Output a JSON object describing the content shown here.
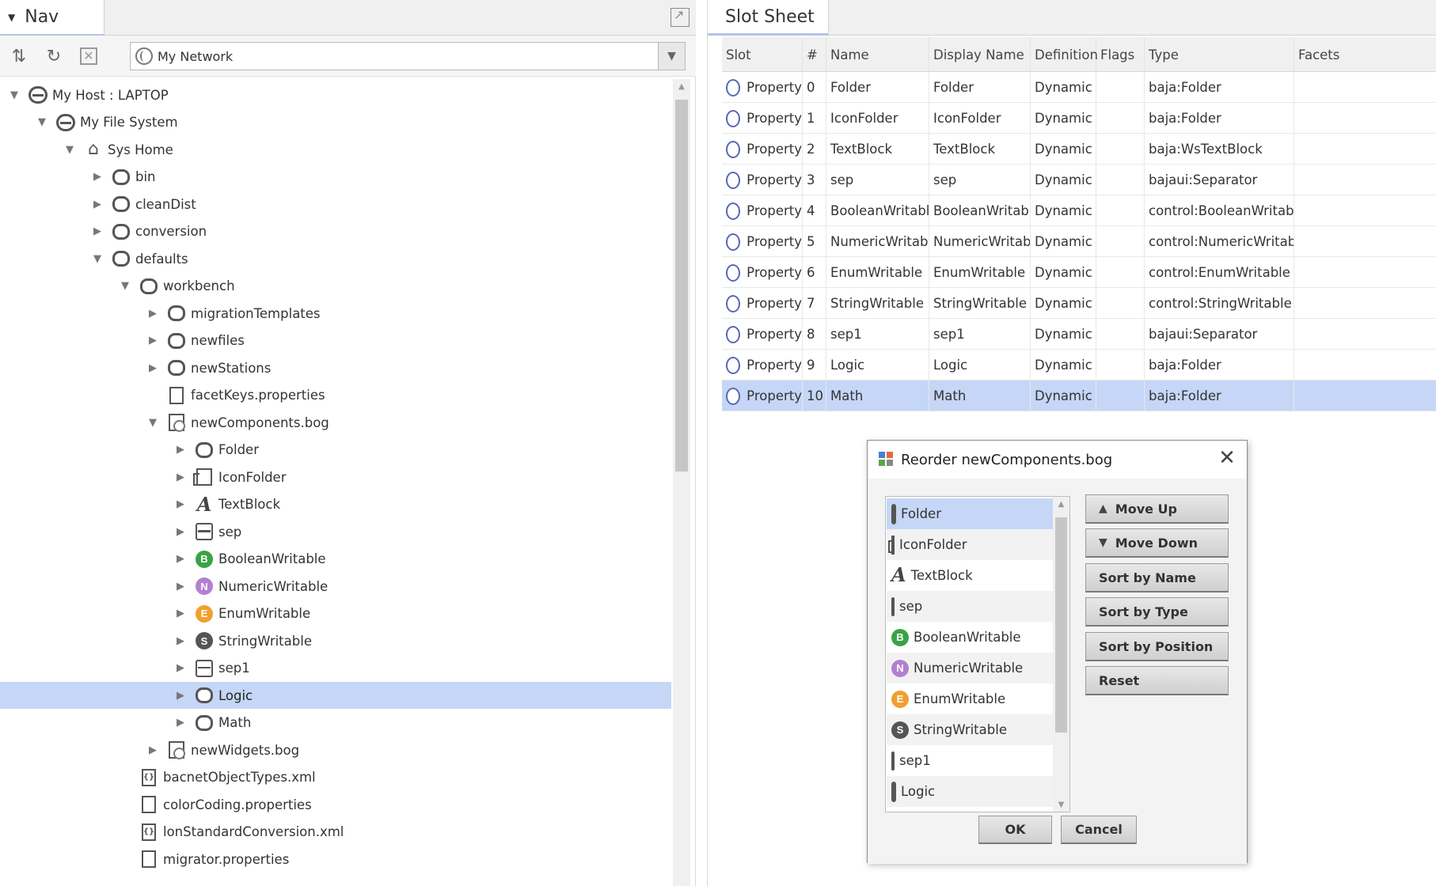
{
  "nav": {
    "tab_label": "Nav",
    "selector_value": "My Network",
    "tree": [
      {
        "label": "My Host : LAPTOP",
        "icon": "host-icon",
        "depth": 0,
        "toggle": "expanded"
      },
      {
        "label": "My File System",
        "icon": "host-icon",
        "depth": 1,
        "toggle": "expanded"
      },
      {
        "label": "Sys Home",
        "icon": "home-icon",
        "depth": 2,
        "toggle": "expanded"
      },
      {
        "label": "bin",
        "icon": "folder-icon",
        "depth": 3,
        "toggle": "collapsed"
      },
      {
        "label": "cleanDist",
        "icon": "folder-icon",
        "depth": 3,
        "toggle": "collapsed"
      },
      {
        "label": "conversion",
        "icon": "folder-icon",
        "depth": 3,
        "toggle": "collapsed"
      },
      {
        "label": "defaults",
        "icon": "folder-icon",
        "depth": 3,
        "toggle": "expanded"
      },
      {
        "label": "workbench",
        "icon": "folder-icon",
        "depth": 4,
        "toggle": "expanded"
      },
      {
        "label": "migrationTemplates",
        "icon": "folder-icon",
        "depth": 5,
        "toggle": "collapsed"
      },
      {
        "label": "newfiles",
        "icon": "folder-icon",
        "depth": 5,
        "toggle": "collapsed"
      },
      {
        "label": "newStations",
        "icon": "folder-icon",
        "depth": 5,
        "toggle": "collapsed"
      },
      {
        "label": "facetKeys.properties",
        "icon": "file-icon",
        "depth": 5,
        "toggle": "none"
      },
      {
        "label": "newComponents.bog",
        "icon": "bog-file-icon",
        "depth": 5,
        "toggle": "expanded"
      },
      {
        "label": "Folder",
        "icon": "folder-icon",
        "depth": 6,
        "toggle": "collapsed"
      },
      {
        "label": "IconFolder",
        "icon": "icon-folder-icon",
        "depth": 6,
        "toggle": "collapsed"
      },
      {
        "label": "TextBlock",
        "icon": "text-block-icon",
        "depth": 6,
        "toggle": "collapsed"
      },
      {
        "label": "sep",
        "icon": "separator-icon",
        "depth": 6,
        "toggle": "collapsed"
      },
      {
        "label": "BooleanWritable",
        "icon": "boolean-writable-icon",
        "depth": 6,
        "toggle": "collapsed"
      },
      {
        "label": "NumericWritable",
        "icon": "numeric-writable-icon",
        "depth": 6,
        "toggle": "collapsed"
      },
      {
        "label": "EnumWritable",
        "icon": "enum-writable-icon",
        "depth": 6,
        "toggle": "collapsed"
      },
      {
        "label": "StringWritable",
        "icon": "string-writable-icon",
        "depth": 6,
        "toggle": "collapsed"
      },
      {
        "label": "sep1",
        "icon": "separator-icon",
        "depth": 6,
        "toggle": "collapsed"
      },
      {
        "label": "Logic",
        "icon": "folder-icon",
        "depth": 6,
        "toggle": "collapsed",
        "selected": true
      },
      {
        "label": "Math",
        "icon": "folder-icon",
        "depth": 6,
        "toggle": "collapsed"
      },
      {
        "label": "newWidgets.bog",
        "icon": "bog-file-icon",
        "depth": 5,
        "toggle": "collapsed"
      },
      {
        "label": "bacnetObjectTypes.xml",
        "icon": "xml-file-icon",
        "depth": 4,
        "toggle": "none"
      },
      {
        "label": "colorCoding.properties",
        "icon": "file-icon",
        "depth": 4,
        "toggle": "none"
      },
      {
        "label": "lonStandardConversion.xml",
        "icon": "xml-file-icon",
        "depth": 4,
        "toggle": "none"
      },
      {
        "label": "migrator.properties",
        "icon": "file-icon",
        "depth": 4,
        "toggle": "none"
      }
    ]
  },
  "slot_sheet": {
    "tab_label": "Slot Sheet",
    "columns": [
      "Slot",
      "#",
      "Name",
      "Display Name",
      "Definition",
      "Flags",
      "Type",
      "Facets"
    ],
    "rows": [
      {
        "slot": "Property",
        "index": "0",
        "name": "Folder",
        "display": "Folder",
        "definition": "Dynamic",
        "flags": "",
        "type": "baja:Folder",
        "facets": ""
      },
      {
        "slot": "Property",
        "index": "1",
        "name": "IconFolder",
        "display": "IconFolder",
        "definition": "Dynamic",
        "flags": "",
        "type": "baja:Folder",
        "facets": ""
      },
      {
        "slot": "Property",
        "index": "2",
        "name": "TextBlock",
        "display": "TextBlock",
        "definition": "Dynamic",
        "flags": "",
        "type": "baja:WsTextBlock",
        "facets": ""
      },
      {
        "slot": "Property",
        "index": "3",
        "name": "sep",
        "display": "sep",
        "definition": "Dynamic",
        "flags": "",
        "type": "bajaui:Separator",
        "facets": ""
      },
      {
        "slot": "Property",
        "index": "4",
        "name": "BooleanWritable",
        "display": "BooleanWritable",
        "definition": "Dynamic",
        "flags": "",
        "type": "control:BooleanWritable",
        "facets": ""
      },
      {
        "slot": "Property",
        "index": "5",
        "name": "NumericWritable",
        "display": "NumericWritable",
        "definition": "Dynamic",
        "flags": "",
        "type": "control:NumericWritable",
        "facets": ""
      },
      {
        "slot": "Property",
        "index": "6",
        "name": "EnumWritable",
        "display": "EnumWritable",
        "definition": "Dynamic",
        "flags": "",
        "type": "control:EnumWritable",
        "facets": ""
      },
      {
        "slot": "Property",
        "index": "7",
        "name": "StringWritable",
        "display": "StringWritable",
        "definition": "Dynamic",
        "flags": "",
        "type": "control:StringWritable",
        "facets": ""
      },
      {
        "slot": "Property",
        "index": "8",
        "name": "sep1",
        "display": "sep1",
        "definition": "Dynamic",
        "flags": "",
        "type": "bajaui:Separator",
        "facets": ""
      },
      {
        "slot": "Property",
        "index": "9",
        "name": "Logic",
        "display": "Logic",
        "definition": "Dynamic",
        "flags": "",
        "type": "baja:Folder",
        "facets": ""
      },
      {
        "slot": "Property",
        "index": "10",
        "name": "Math",
        "display": "Math",
        "definition": "Dynamic",
        "flags": "",
        "type": "baja:Folder",
        "facets": "",
        "selected": true
      }
    ]
  },
  "dialog": {
    "title": "Reorder newComponents.bog",
    "items": [
      {
        "label": "Folder",
        "icon": "folder-icon",
        "selected": true
      },
      {
        "label": "IconFolder",
        "icon": "icon-folder-icon"
      },
      {
        "label": "TextBlock",
        "icon": "text-block-icon"
      },
      {
        "label": "sep",
        "icon": "separator-icon"
      },
      {
        "label": "BooleanWritable",
        "icon": "boolean-writable-icon"
      },
      {
        "label": "NumericWritable",
        "icon": "numeric-writable-icon"
      },
      {
        "label": "EnumWritable",
        "icon": "enum-writable-icon"
      },
      {
        "label": "StringWritable",
        "icon": "string-writable-icon"
      },
      {
        "label": "sep1",
        "icon": "separator-icon"
      },
      {
        "label": "Logic",
        "icon": "folder-icon"
      }
    ],
    "buttons": {
      "move_up": "Move Up",
      "move_down": "Move Down",
      "sort_name": "Sort by Name",
      "sort_type": "Sort by Type",
      "sort_position": "Sort by Position",
      "reset": "Reset",
      "ok": "OK",
      "cancel": "Cancel"
    }
  },
  "colors": {
    "selection": "#c5d6f7",
    "slot_ring": "#5567b8",
    "boolean_badge": "#3aa346",
    "numeric_badge": "#b47fd0",
    "enum_badge": "#f0a030",
    "string_badge": "#555555"
  },
  "badges": {
    "boolean": "B",
    "numeric": "N",
    "enum": "E",
    "string": "S"
  }
}
